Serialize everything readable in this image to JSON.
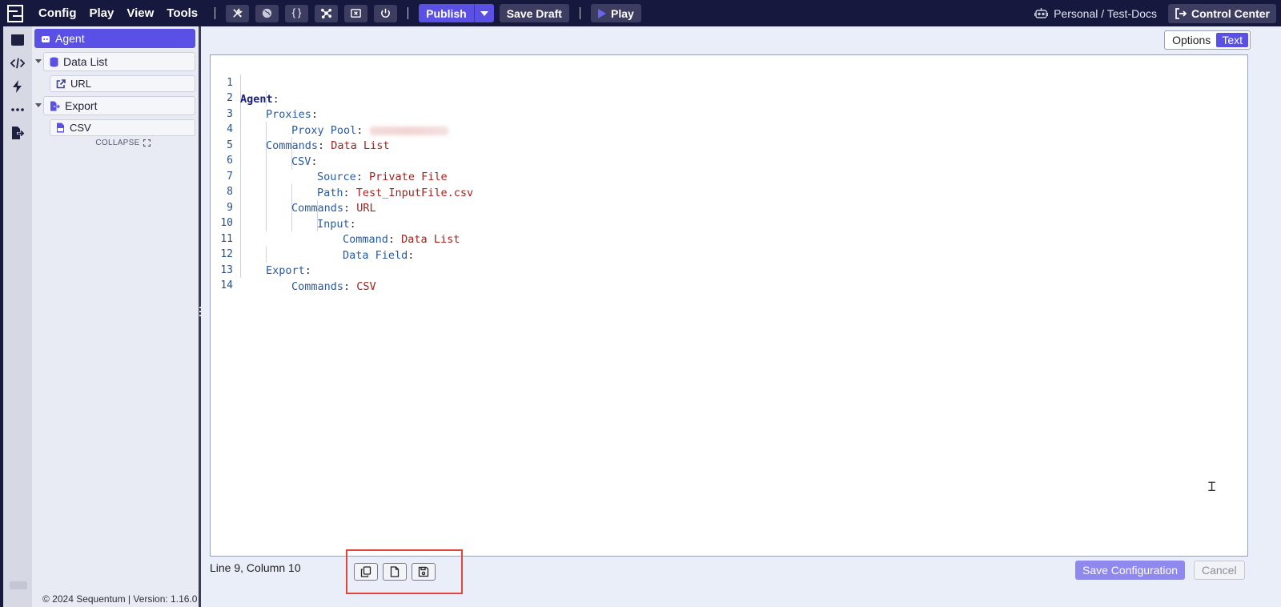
{
  "topbar": {
    "menu": [
      "Config",
      "Play",
      "View",
      "Tools"
    ],
    "tools": [
      "wrench-screwdriver-icon",
      "globe-icon",
      "braces-icon",
      "network-icon",
      "close-box-icon",
      "power-icon"
    ],
    "publish_label": "Publish",
    "save_draft_label": "Save Draft",
    "play_label": "Play",
    "workspace_label": "Personal / Test-Docs",
    "control_center_label": "Control Center"
  },
  "rail": {
    "icons": [
      "window-icon",
      "code-icon",
      "bolt-icon",
      "more-icon",
      "export-icon"
    ]
  },
  "tree": {
    "nodes": [
      {
        "label": "Agent",
        "icon": "robot-icon",
        "selected": true
      },
      {
        "label": "Data List",
        "icon": "database-icon"
      },
      {
        "label": "URL",
        "icon": "external-link-icon"
      },
      {
        "label": "Export",
        "icon": "file-export-icon"
      },
      {
        "label": "CSV",
        "icon": "csv-file-icon"
      }
    ],
    "collapse_label": "COLLAPSE"
  },
  "footer": {
    "text": "© 2024 Sequentum | Version: 1.16.0"
  },
  "mode_toggle": {
    "options_label": "Options",
    "text_label": "Text",
    "active": "Text"
  },
  "editor": {
    "lines": [
      {
        "n": "1",
        "key": "Agent",
        "value": ""
      },
      {
        "n": "2",
        "key": "Proxies",
        "value": ""
      },
      {
        "n": "3",
        "key": "Proxy Pool",
        "value": "",
        "blurred": true
      },
      {
        "n": "4",
        "key": "Commands",
        "value": "Data List"
      },
      {
        "n": "5",
        "key": "CSV",
        "value": ""
      },
      {
        "n": "6",
        "key": "Source",
        "value": "Private File"
      },
      {
        "n": "7",
        "key": "Path",
        "value": "Test_InputFile.csv"
      },
      {
        "n": "8",
        "key": "Commands",
        "value": "URL"
      },
      {
        "n": "9",
        "key": "Input",
        "value": ""
      },
      {
        "n": "10",
        "key": "Command",
        "value": "Data List"
      },
      {
        "n": "11",
        "key": "Data Field",
        "value": ""
      },
      {
        "n": "12",
        "key": "Export",
        "value": ""
      },
      {
        "n": "13",
        "key": "Commands",
        "value": "CSV"
      },
      {
        "n": "14",
        "key": "",
        "value": ""
      }
    ],
    "status": "Line 9, Column 10"
  },
  "actions": {
    "file_tools": [
      "copy-icon",
      "new-file-icon",
      "save-icon"
    ],
    "save_label": "Save Configuration",
    "cancel_label": "Cancel"
  },
  "colors": {
    "topbar_bg": "#17183d",
    "accent": "#5a50e6",
    "highlight_box": "#e0463a",
    "yaml_key": "#2c5a9e",
    "yaml_value": "#a1231f"
  }
}
